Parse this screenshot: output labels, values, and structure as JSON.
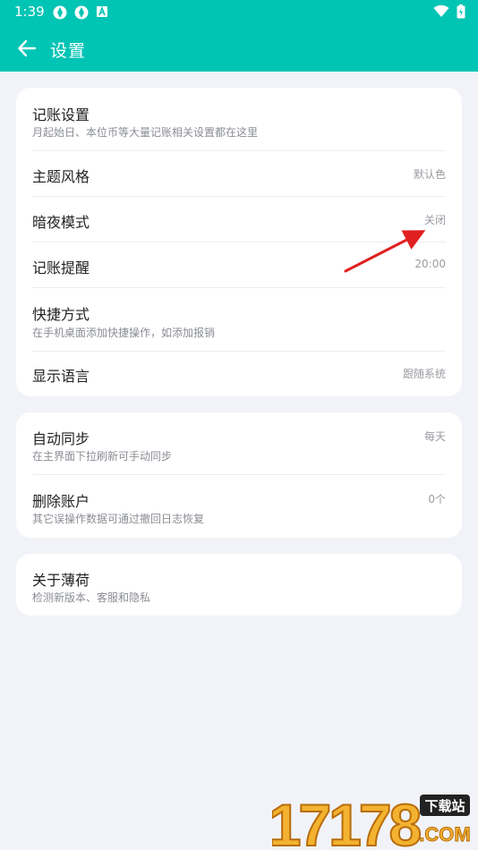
{
  "status_bar": {
    "time": "1:39"
  },
  "header": {
    "title": "设置"
  },
  "cards": [
    {
      "rows": [
        {
          "title": "记账设置",
          "subtitle": "月起始日、本位币等大量记账相关设置都在这里",
          "value": ""
        },
        {
          "title": "主题风格",
          "subtitle": "",
          "value": "默认色"
        },
        {
          "title": "暗夜模式",
          "subtitle": "",
          "value": "关闭"
        },
        {
          "title": "记账提醒",
          "subtitle": "",
          "value": "20:00"
        },
        {
          "title": "快捷方式",
          "subtitle": "在手机桌面添加快捷操作，如添加报销",
          "value": ""
        },
        {
          "title": "显示语言",
          "subtitle": "",
          "value": "跟随系统"
        }
      ]
    },
    {
      "rows": [
        {
          "title": "自动同步",
          "subtitle": "在主界面下拉刷新可手动同步",
          "value": "每天"
        },
        {
          "title": "删除账户",
          "subtitle": "其它误操作数据可通过撤回日志恢复",
          "value": "0个"
        }
      ]
    },
    {
      "rows": [
        {
          "title": "关于薄荷",
          "subtitle": "检测新版本、客服和隐私",
          "value": ""
        }
      ]
    }
  ],
  "watermark": {
    "digits": "17178",
    "tag": "下载站",
    "domain": ".COM"
  },
  "colors": {
    "accent": "#00c4b4",
    "background": "#f1f3f8",
    "annotation_arrow": "#e02020"
  }
}
